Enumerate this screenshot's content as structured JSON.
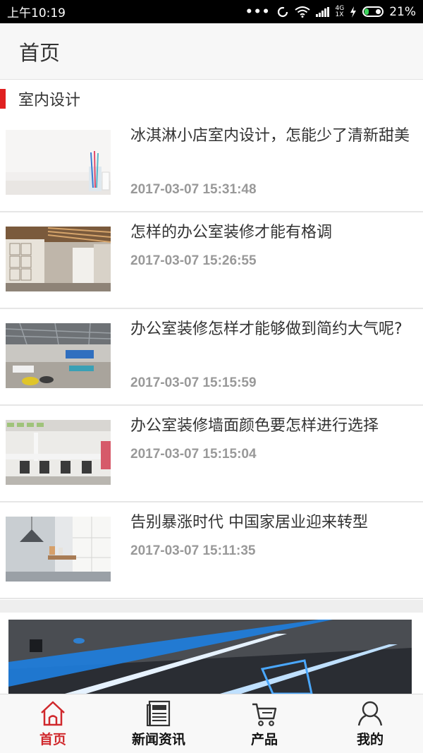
{
  "status_bar": {
    "time": "上午10:19",
    "dots": "•••",
    "net_top": "4G",
    "net_bottom": "1X",
    "battery": "21%",
    "battery_level": 0.21
  },
  "header": {
    "title": "首页"
  },
  "section": {
    "title": "室内设计"
  },
  "articles": [
    {
      "title": "冰淇淋小店室内设计，怎能少了清新甜美",
      "date": "2017-03-07 15:31:48"
    },
    {
      "title": "怎样的办公室装修才能有格调",
      "date": "2017-03-07 15:26:55"
    },
    {
      "title": "办公室装修怎样才能够做到简约大气呢?",
      "date": "2017-03-07 15:15:59"
    },
    {
      "title": "办公室装修墙面颜色要怎样进行选择",
      "date": "2017-03-07 15:15:04"
    },
    {
      "title": "告别暴涨时代 中国家居业迎来转型",
      "date": "2017-03-07 15:11:35"
    }
  ],
  "tabs": [
    {
      "label": "首页",
      "icon": "home-icon",
      "active": true
    },
    {
      "label": "新闻资讯",
      "icon": "news-icon",
      "active": false
    },
    {
      "label": "产品",
      "icon": "cart-icon",
      "active": false
    },
    {
      "label": "我的",
      "icon": "user-icon",
      "active": false
    }
  ],
  "colors": {
    "accent": "#d0282c",
    "section_marker": "#e02020",
    "date": "#999999"
  }
}
